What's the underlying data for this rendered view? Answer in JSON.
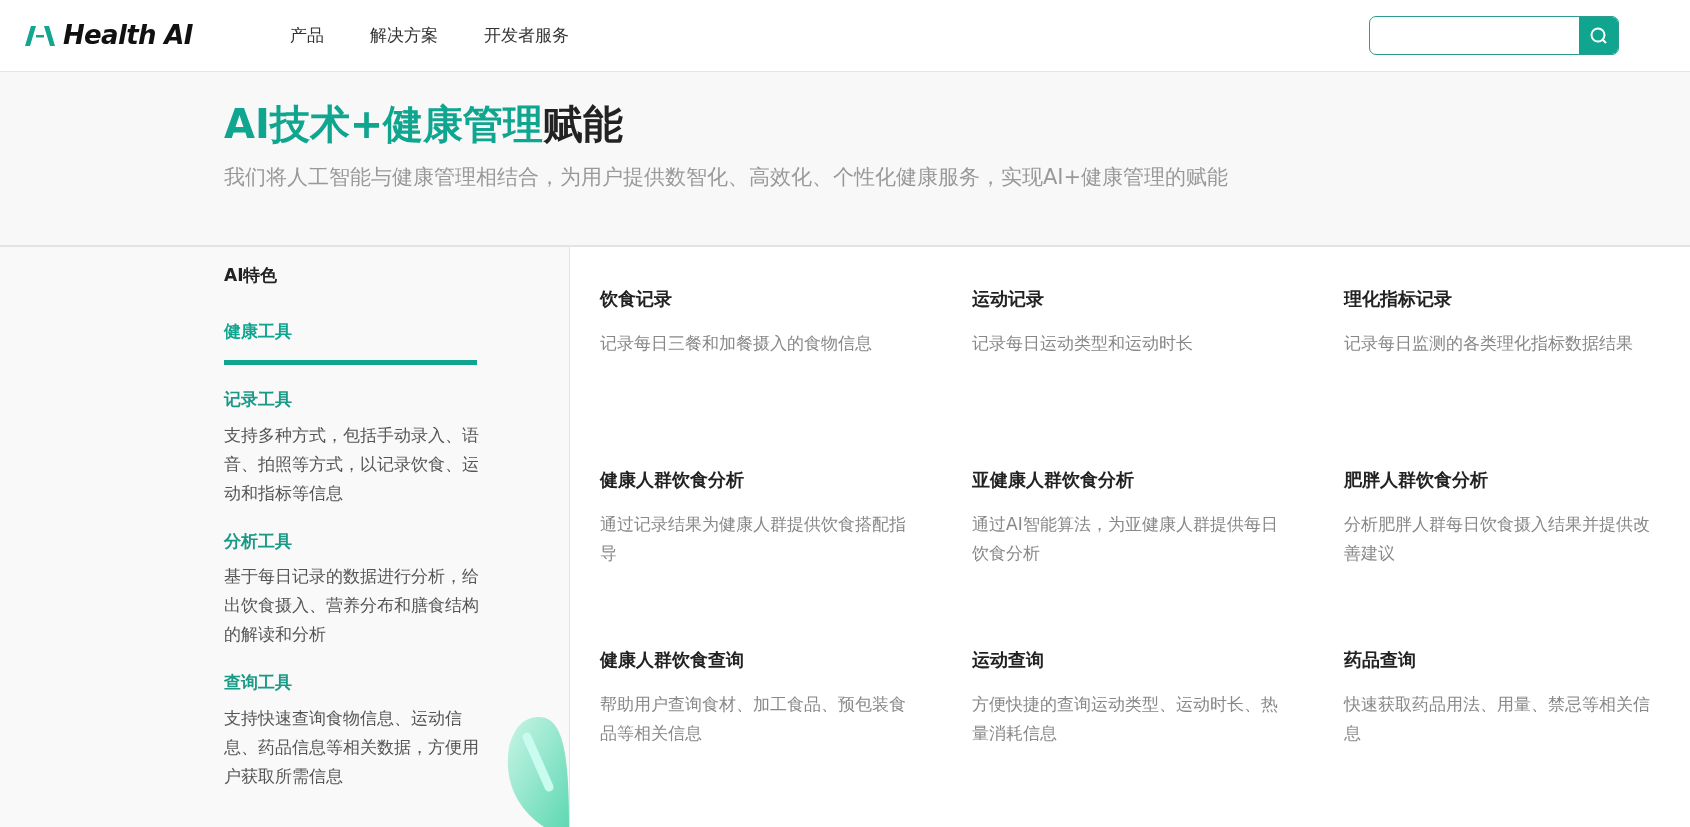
{
  "header": {
    "logo_text": "Health AI",
    "nav": [
      {
        "label": "产品"
      },
      {
        "label": "解决方案"
      },
      {
        "label": "开发者服务"
      }
    ]
  },
  "hero": {
    "title_highlight": "AI技术+健康管理",
    "title_rest": "赋能",
    "subtitle": "我们将人工智能与健康管理相结合，为用户提供数智化、高效化、个性化健康服务，实现AI+健康管理的赋能"
  },
  "sidebar": {
    "heading": "AI特色",
    "tabs": [
      {
        "label": "健康工具",
        "selected": true
      }
    ],
    "sections": [
      {
        "title": "记录工具",
        "text": "支持多种方式，包括手动录入、语音、拍照等方式，以记录饮食、运动和指标等信息"
      },
      {
        "title": "分析工具",
        "text": "基于每日记录的数据进行分析，给出饮食摄入、营养分布和膳食结构的解读和分析"
      },
      {
        "title": "查询工具",
        "text": "支持快速查询食物信息、运动信息、药品信息等相关数据，方便用户获取所需信息"
      }
    ]
  },
  "features": [
    {
      "title": "饮食记录",
      "text": "记录每日三餐和加餐摄入的食物信息"
    },
    {
      "title": "运动记录",
      "text": "记录每日运动类型和运动时长"
    },
    {
      "title": "理化指标记录",
      "text": "记录每日监测的各类理化指标数据结果"
    },
    {
      "title": "健康人群饮食分析",
      "text": "通过记录结果为健康人群提供饮食搭配指导"
    },
    {
      "title": "亚健康人群饮食分析",
      "text": "通过AI智能算法，为亚健康人群提供每日饮食分析"
    },
    {
      "title": "肥胖人群饮食分析",
      "text": "分析肥胖人群每日饮食摄入结果并提供改善建议"
    },
    {
      "title": "健康人群饮食查询",
      "text": "帮助用户查询食材、加工食品、预包装食品等相关信息"
    },
    {
      "title": "运动查询",
      "text": "方便快捷的查询运动类型、运动时长、热量消耗信息"
    },
    {
      "title": "药品查询",
      "text": "快速获取药品用法、用量、禁忌等相关信息"
    }
  ]
}
